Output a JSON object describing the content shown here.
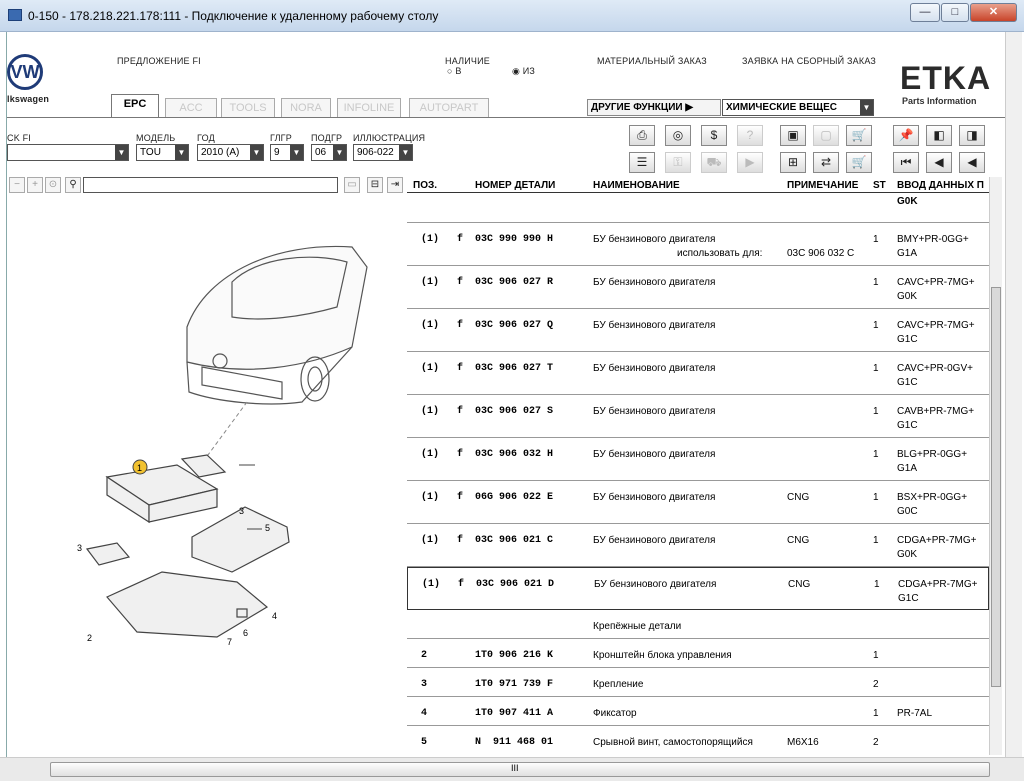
{
  "window": {
    "title": "0-150 - 178.218.221.178:111 - Подключение к удаленному рабочему столу"
  },
  "brand": {
    "logo_text": "VW",
    "name": "lkswagen",
    "etka": "ETKA",
    "etka_sub": "Parts Information"
  },
  "header": {
    "offer": "ПРЕДЛОЖЕНИЕ FI",
    "availability": "НАЛИЧИЕ",
    "avail_b": "В",
    "avail_iz": "ИЗ",
    "material_order": "МАТЕРИАЛЬНЫЙ ЗАКАЗ",
    "assembly_order": "ЗАЯВКА НА СБОРНЫЙ ЗАКАЗ"
  },
  "tabs": [
    {
      "label": "EPC"
    },
    {
      "label": "ACC"
    },
    {
      "label": "TOOLS"
    },
    {
      "label": "NORA"
    },
    {
      "label": "INFOLINE"
    },
    {
      "label": "AUTOPART"
    }
  ],
  "other_functions": "ДРУГИЕ ФУНКЦИИ ▶",
  "chem_select": "ХИМИЧЕСКИЕ ВЕЩЕС",
  "filters": {
    "stock": {
      "label": "CK FI",
      "value": ""
    },
    "model": {
      "label": "МОДЕЛЬ",
      "value": "TOU"
    },
    "year": {
      "label": "ГОД",
      "value": "2010 (A)"
    },
    "group": {
      "label": "ГЛГР",
      "value": "9"
    },
    "subgroup": {
      "label": "ПОДГР",
      "value": "06"
    },
    "illustration": {
      "label": "ИЛЛЮСТРАЦИЯ",
      "value": "906-022"
    }
  },
  "table": {
    "headers": {
      "pos": "ПОЗ.",
      "part": "НОМЕР ДЕТАЛИ",
      "name": "НАИМЕНОВАНИЕ",
      "note": "ПРИМЕЧАНИЕ",
      "st": "ST",
      "input": "ВВОД ДАННЫХ П"
    },
    "top_fragment": "G0K",
    "rows": [
      {
        "pos": "(1)",
        "f": "f",
        "part": "03C 990 990 H",
        "name": "БУ бензинового двигателя",
        "usefor": "использовать для:",
        "usefor_part": "03C 906 032 C",
        "note": "",
        "st": "1",
        "in1": "BMY+PR-0GG+",
        "in2": "G1A"
      },
      {
        "pos": "(1)",
        "f": "f",
        "part": "03C 906 027 R",
        "name": "БУ бензинового двигателя",
        "note": "",
        "st": "1",
        "in1": "CAVC+PR-7MG+",
        "in2": "G0K"
      },
      {
        "pos": "(1)",
        "f": "f",
        "part": "03C 906 027 Q",
        "name": "БУ бензинового двигателя",
        "note": "",
        "st": "1",
        "in1": "CAVC+PR-7MG+",
        "in2": "G1C"
      },
      {
        "pos": "(1)",
        "f": "f",
        "part": "03C 906 027 T",
        "name": "БУ бензинового двигателя",
        "note": "",
        "st": "1",
        "in1": "CAVC+PR-0GV+",
        "in2": "G1C"
      },
      {
        "pos": "(1)",
        "f": "f",
        "part": "03C 906 027 S",
        "name": "БУ бензинового двигателя",
        "note": "",
        "st": "1",
        "in1": "CAVB+PR-7MG+",
        "in2": "G1C"
      },
      {
        "pos": "(1)",
        "f": "f",
        "part": "03C 906 032 H",
        "name": "БУ бензинового двигателя",
        "note": "",
        "st": "1",
        "in1": "BLG+PR-0GG+",
        "in2": "G1A"
      },
      {
        "pos": "(1)",
        "f": "f",
        "part": "06G 906 022 E",
        "name": "БУ бензинового двигателя",
        "note": "CNG",
        "st": "1",
        "in1": "BSX+PR-0GG+",
        "in2": "G0C"
      },
      {
        "pos": "(1)",
        "f": "f",
        "part": "03C 906 021 C",
        "name": "БУ бензинового двигателя",
        "note": "CNG",
        "st": "1",
        "in1": "CDGA+PR-7MG+",
        "in2": "G0K"
      },
      {
        "pos": "(1)",
        "f": "f",
        "part": "03C 906 021 D",
        "name": "БУ бензинового двигателя",
        "note": "CNG",
        "st": "1",
        "in1": "CDGA+PR-7MG+",
        "in2": "G1C"
      },
      {
        "pos": "",
        "f": "",
        "part": "",
        "name": "Крепёжные детали",
        "note": "",
        "st": "",
        "in1": "",
        "in2": ""
      },
      {
        "pos": "2",
        "f": "",
        "part": "1T0 906 216 K",
        "name": "Кронштейн блока управления",
        "note": "",
        "st": "1",
        "in1": "",
        "in2": ""
      },
      {
        "pos": "3",
        "f": "",
        "part": "1T0 971 739 F",
        "name": "Крепление",
        "note": "",
        "st": "2",
        "in1": "",
        "in2": ""
      },
      {
        "pos": "4",
        "f": "",
        "part": "1T0 907 411 A",
        "name": "Фиксатор",
        "note": "",
        "st": "1",
        "in1": "PR-7AL",
        "in2": ""
      },
      {
        "pos": "5",
        "f": "",
        "part": "N  911 468 01",
        "name": "Срывной винт, самостопорящийся",
        "note": "M6X16",
        "st": "2",
        "in1": "",
        "in2": ""
      }
    ]
  },
  "illustration": {
    "callouts": [
      "1",
      "2",
      "3",
      "3",
      "4",
      "5",
      "6",
      "6",
      "7"
    ]
  },
  "hscroll_label": "III"
}
